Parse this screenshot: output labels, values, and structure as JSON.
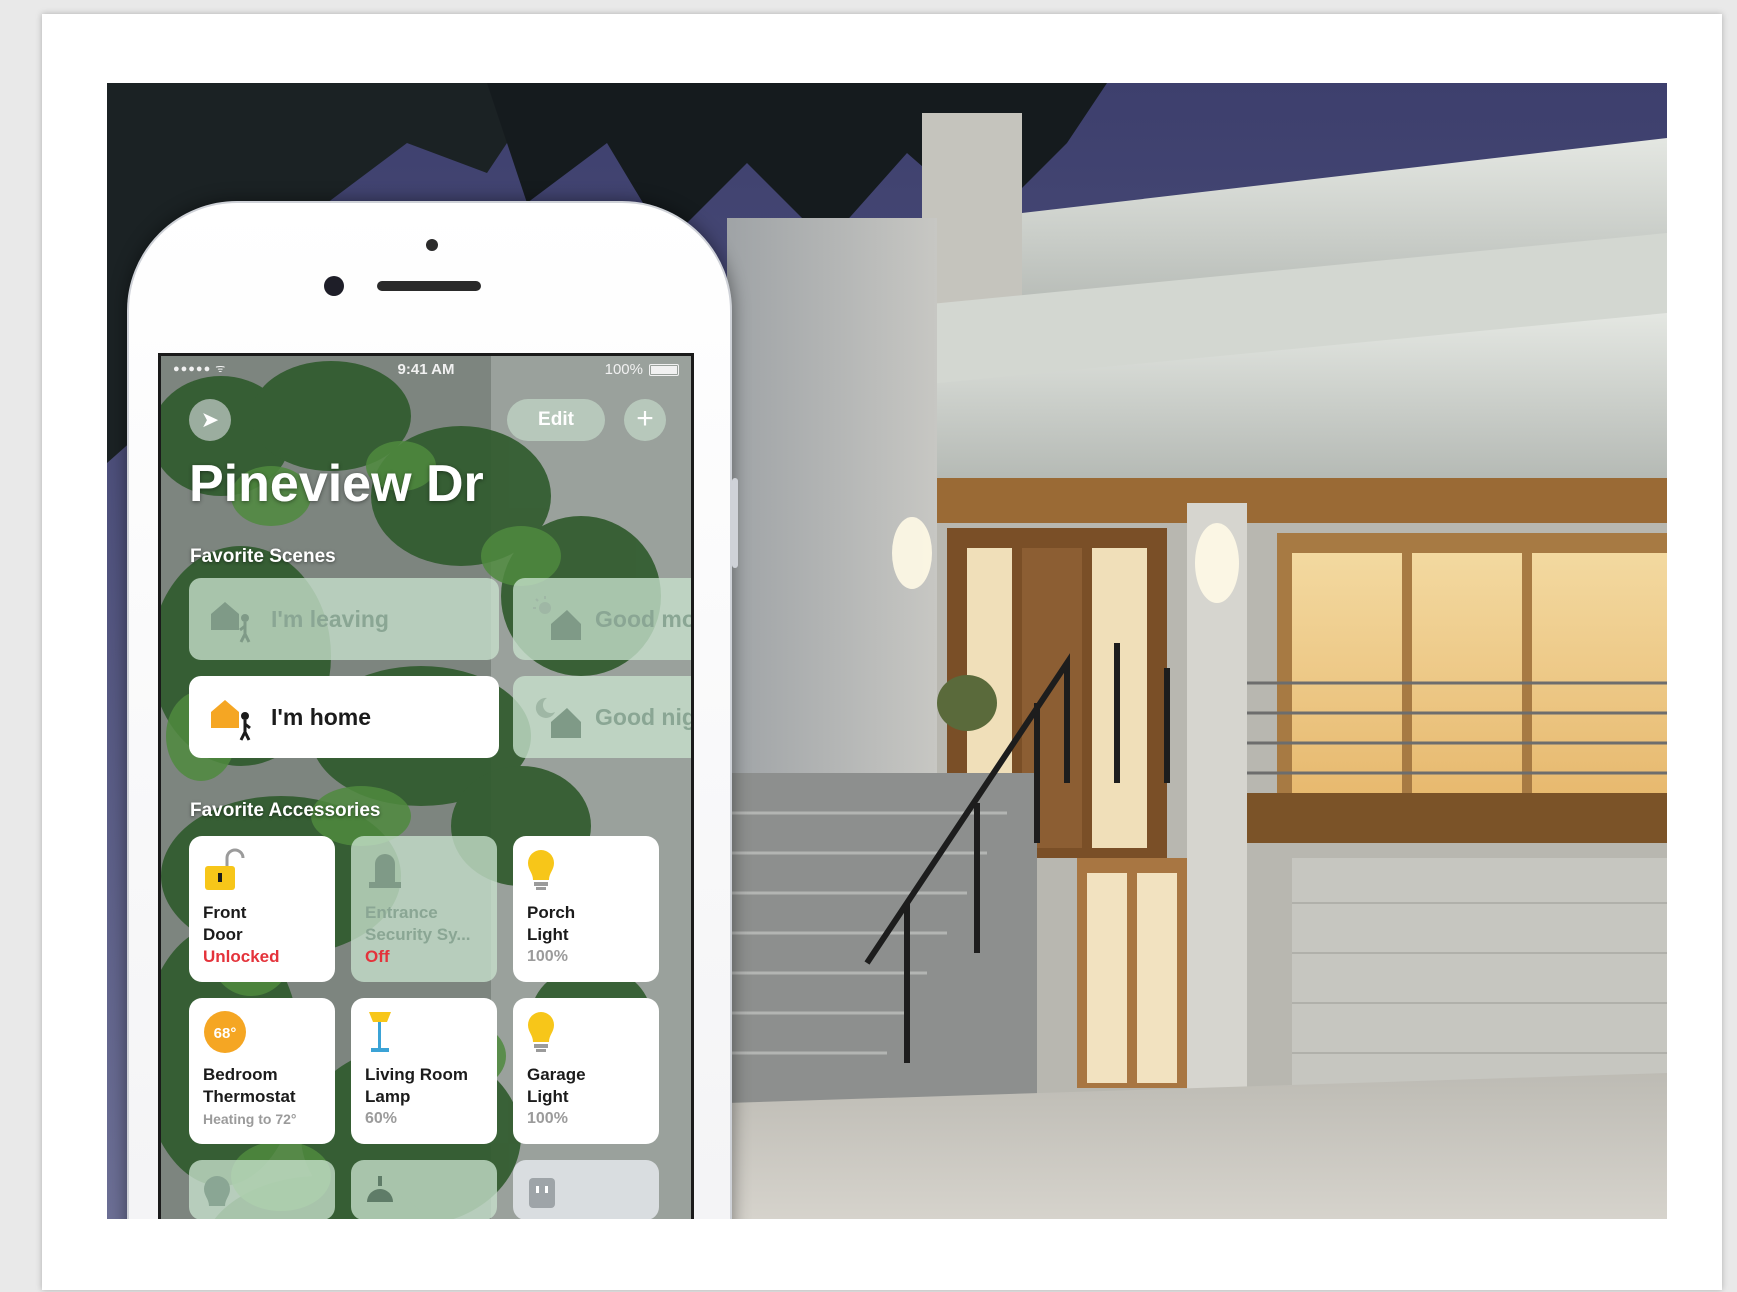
{
  "status_bar": {
    "signal": "●●●●● ᯤ",
    "time": "9:41 AM",
    "battery": "100%"
  },
  "toolbar": {
    "location_icon": "location-arrow-icon",
    "edit_label": "Edit",
    "add_label": "+"
  },
  "home": {
    "title": "Pineview Dr"
  },
  "scenes": {
    "section_label": "Favorite Scenes",
    "items": [
      {
        "label": "I'm leaving",
        "icon": "house-leaving-icon",
        "active": false
      },
      {
        "label": "Good mo",
        "icon": "sunrise-house-icon",
        "active": false
      },
      {
        "label": "I'm home",
        "icon": "house-arriving-icon",
        "active": true
      },
      {
        "label": "Good nig",
        "icon": "moon-house-icon",
        "active": false
      }
    ]
  },
  "accessories": {
    "section_label": "Favorite Accessories",
    "items": [
      {
        "line1": "Front",
        "line2": "Door",
        "status": "Unlocked",
        "icon": "lock-open-icon",
        "active": true
      },
      {
        "line1": "Entrance",
        "line2": "Security Sy...",
        "status": "Off",
        "icon": "alarm-siren-icon",
        "active": false
      },
      {
        "line1": "Porch",
        "line2": "Light",
        "status": "100%",
        "icon": "lightbulb-icon",
        "active": true
      },
      {
        "line1": "Bedroom",
        "line2": "Thermostat",
        "status": "Heating to 72°",
        "icon": "thermostat-icon",
        "badge": "68°",
        "active": true
      },
      {
        "line1": "Living Room",
        "line2": "Lamp",
        "status": "60%",
        "icon": "floor-lamp-icon",
        "active": true
      },
      {
        "line1": "Garage",
        "line2": "Light",
        "status": "100%",
        "icon": "lightbulb-icon",
        "active": true
      }
    ]
  },
  "colors": {
    "tile_on": "#ffffff",
    "tile_off": "#c8e1cd",
    "status_red": "#e4333b",
    "accent_amber": "#f5a623",
    "bulb_yellow": "#f7c619"
  }
}
